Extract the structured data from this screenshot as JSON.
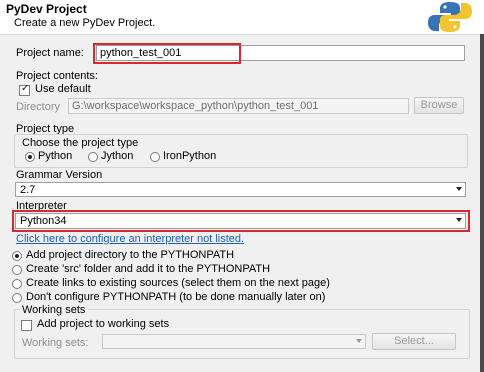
{
  "header": {
    "title": "PyDev Project",
    "subtitle": "Create a new PyDev Project."
  },
  "project_name": {
    "label": "Project name:",
    "value": "python_test_001"
  },
  "project_contents": {
    "label": "Project contents:",
    "use_default_label": "Use default",
    "use_default_checked": true,
    "directory_label": "Directory",
    "directory_value": "G:\\workspace\\workspace_python\\python_test_001",
    "browse_label": "Browse"
  },
  "project_type": {
    "label": "Project type",
    "choose_label": "Choose the project type",
    "options": [
      "Python",
      "Jython",
      "IronPython"
    ],
    "selected": "Python"
  },
  "grammar": {
    "label": "Grammar Version",
    "value": "2.7"
  },
  "interpreter": {
    "label": "Interpreter",
    "value": "Python34",
    "configure_link": "Click here to configure an interpreter not listed."
  },
  "pythonpath_options": {
    "options": [
      "Add project directory to the PYTHONPATH",
      "Create 'src' folder and add it to the PYTHONPATH",
      "Create links to existing sources (select them on the next page)",
      "Don't configure PYTHONPATH (to be done manually later on)"
    ],
    "selected_index": 0
  },
  "working_sets": {
    "label": "Working sets",
    "add_label": "Add project to working sets",
    "add_checked": false,
    "sets_label": "Working sets:",
    "sets_value": "",
    "select_button": "Select..."
  },
  "colors": {
    "highlight": "#d9292b",
    "link": "#1a5fc2"
  }
}
